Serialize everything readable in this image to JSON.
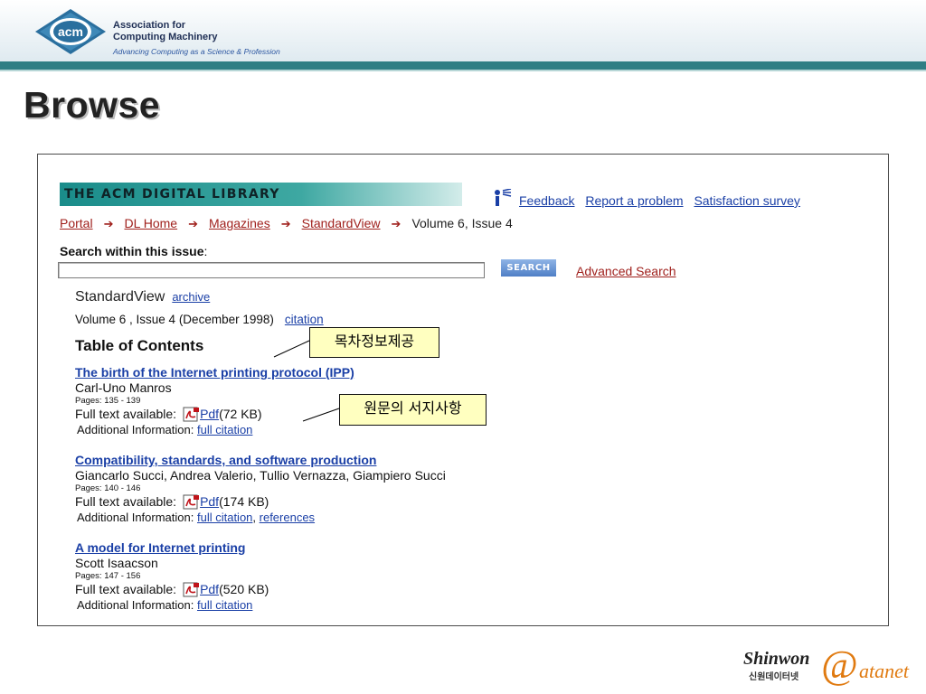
{
  "header": {
    "logo_text": "acm",
    "org_line1": "Association for",
    "org_line2": "Computing Machinery",
    "tagline": "Advancing Computing as a Science & Profession"
  },
  "slide_title": "Browse",
  "dl": {
    "banner": "THE ACM DIGITAL LIBRARY",
    "feedback_icon": "feedback-icon",
    "links": [
      "Feedback",
      "Report a problem",
      "Satisfaction survey"
    ]
  },
  "breadcrumb": {
    "items": [
      "Portal",
      "DL Home",
      "Magazines",
      "StandardView"
    ],
    "current": "Volume 6, Issue 4"
  },
  "search": {
    "label_bold": "Search within this issue",
    "label_rest": ":",
    "value": "",
    "button": "SEARCH",
    "advanced": "Advanced Search"
  },
  "publication": {
    "name": "StandardView",
    "archive_link": "archive",
    "volume_line": "Volume 6 ,  Issue 4  (December 1998)",
    "citation_link": "citation",
    "toc_heading": "Table of Contents"
  },
  "articles": [
    {
      "title": "The birth of the Internet printing protocol (IPP)",
      "authors": "Carl-Uno Manros",
      "pages": "Pages: 135 - 139",
      "full_label": "Full text available:",
      "pdf_link": "Pdf",
      "size": "(72 KB)",
      "add_label": "Additional Information:",
      "add_links": [
        "full citation"
      ]
    },
    {
      "title": "Compatibility, standards, and software production",
      "authors": "Giancarlo Succi, Andrea Valerio, Tullio Vernazza, Giampiero Succi",
      "pages": "Pages: 140 - 146",
      "full_label": "Full text available:",
      "pdf_link": "Pdf",
      "size": "(174 KB)",
      "add_label": "Additional Information:",
      "add_links": [
        "full citation",
        "references"
      ]
    },
    {
      "title": "A model for Internet printing",
      "authors": "Scott Isaacson",
      "pages": "Pages: 147 - 156",
      "full_label": "Full text available:",
      "pdf_link": "Pdf",
      "size": "(520 KB)",
      "add_label": "Additional Information:",
      "add_links": [
        "full citation"
      ]
    }
  ],
  "callouts": [
    "목차정보제공",
    "원문의 서지사항"
  ],
  "footer_logo": {
    "name": "Shinwon",
    "korean": "신원데이터넷",
    "at": "@",
    "suffix": "atanet"
  }
}
